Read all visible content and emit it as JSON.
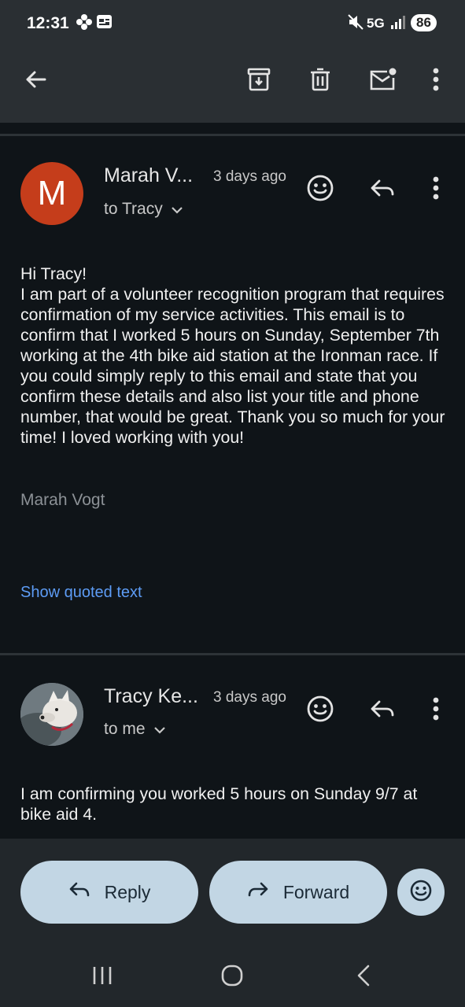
{
  "status_bar": {
    "time": "12:31",
    "network": "5G",
    "battery": "86",
    "icons": [
      "flower-icon",
      "calendar-icon",
      "mute-icon",
      "signal-icon"
    ]
  },
  "toolbar": {
    "icons": [
      "back-arrow-icon",
      "archive-icon",
      "delete-icon",
      "mark-unread-icon",
      "more-vert-icon"
    ]
  },
  "messages": [
    {
      "avatar_letter": "M",
      "avatar_color": "#c53d1b",
      "sender": "Marah V...",
      "time": "3 days ago",
      "recipient": "to Tracy",
      "body": "Hi Tracy!\nI am part of a volunteer recognition program that requires confirmation of my service activities. This email is to confirm that I worked 5 hours on Sunday, September 7th working at the 4th bike aid station at the Ironman race. If you could simply reply to this email and state that you confirm these details and also list your title and phone number, that would be great. Thank you so much for your time! I loved working with you!",
      "signature": "Marah Vogt",
      "show_quoted": "Show quoted text"
    },
    {
      "sender": "Tracy Ke...",
      "time": "3 days ago",
      "recipient": "to me",
      "body": "I am confirming you worked 5 hours on Sunday 9/7 at bike aid 4."
    }
  ],
  "actions": {
    "reply": "Reply",
    "forward": "Forward"
  },
  "colors": {
    "background": "#0f1418",
    "appbar": "#2a2f33",
    "pill": "#c2d6e4",
    "link": "#5d9cf5"
  }
}
